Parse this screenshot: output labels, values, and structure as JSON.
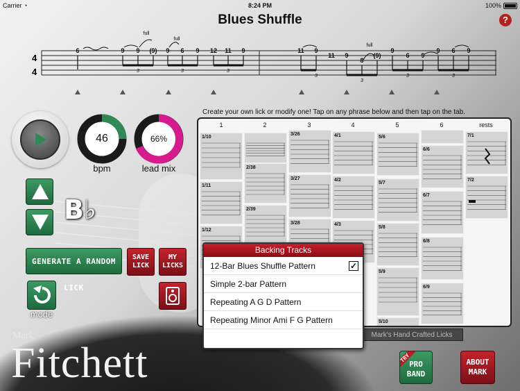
{
  "status": {
    "carrier": "Carrier",
    "time": "8:24 PM",
    "battery": "100%"
  },
  "title": "Blues Shuffle",
  "help": "?",
  "notation": {
    "time_sig_top": "4",
    "time_sig_bottom": "4",
    "bend_labels": [
      "full",
      "full",
      "full"
    ],
    "fret_numbers_bar1": [
      "6",
      "9",
      "9",
      "(9)",
      "9",
      "6",
      "9",
      "12",
      "11",
      "9"
    ],
    "fret_numbers_bar2": [
      "11",
      "9",
      "11",
      "9",
      "8",
      "(9)",
      "9",
      "6",
      "9",
      "9",
      "6",
      "9"
    ],
    "triplet_marks": [
      "3",
      "3",
      "3",
      "3",
      "3",
      "3",
      "3"
    ]
  },
  "instruction": "Create your own lick or modify one!  Tap on any phrase below and then tap on the tab.",
  "tempo": {
    "value": "46",
    "label": "bpm",
    "color": "#2e8b57"
  },
  "lead_mix": {
    "value": "66%",
    "label": "lead mix",
    "color": "#d81b8c"
  },
  "key": "B♭",
  "buttons": {
    "generate": "GENERATE A RANDOM LICK",
    "save_lick_1": "SAVE",
    "save_lick_2": "LICK",
    "my_licks_1": "MY",
    "my_licks_2": "LICKS",
    "mode": "mode",
    "try": "TRY",
    "pro_1": "PRO",
    "pro_2": "BAND",
    "about_1": "ABOUT",
    "about_2": "MARK"
  },
  "brand": {
    "small": "Mark",
    "large": "Fitchett"
  },
  "phrases": {
    "columns": [
      "1",
      "2",
      "3",
      "4",
      "5",
      "6",
      "rests"
    ],
    "items": [
      [
        "1/10",
        "1/11",
        "1/12"
      ],
      [
        "2/38",
        "2/39"
      ],
      [
        "3/26",
        "3/27",
        "3/28"
      ],
      [
        "4/1",
        "4/2",
        "4/3"
      ],
      [
        "5/6",
        "5/7",
        "5/8",
        "5/9",
        "5/10"
      ],
      [
        "6/6",
        "6/7",
        "6/8",
        "6/9"
      ],
      [
        "7/1",
        "7/2"
      ]
    ]
  },
  "backing": {
    "title": "Backing Tracks",
    "items": [
      {
        "label": "12-Bar Blues Shuffle Pattern",
        "checked": true
      },
      {
        "label": "Simple 2-bar Pattern",
        "checked": false
      },
      {
        "label": "Repeating A G D Pattern",
        "checked": false
      },
      {
        "label": "Repeating Minor Ami F G Pattern",
        "checked": false
      }
    ]
  },
  "crafted_label": "Mark's Hand Crafted Licks",
  "colors": {
    "green": "#2e8b57",
    "red": "#b3221b",
    "pink": "#d81b8c"
  }
}
